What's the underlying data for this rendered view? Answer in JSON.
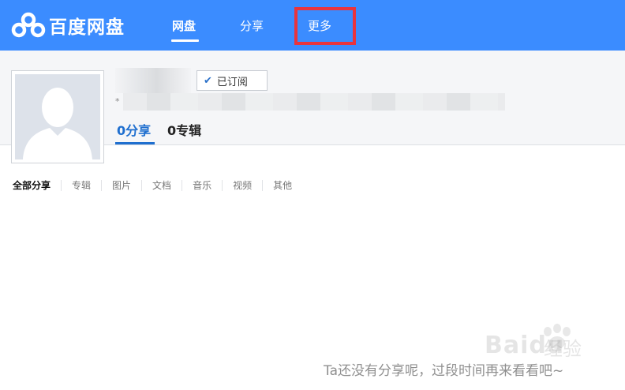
{
  "header": {
    "logo_text": "百度网盘",
    "nav": [
      {
        "label": "网盘",
        "active": true
      },
      {
        "label": "分享",
        "active": false
      },
      {
        "label": "更多",
        "active": false
      }
    ],
    "highlight_color": "#e8343d",
    "bar_color": "#3b8cff"
  },
  "profile": {
    "subscribe_label": "已订阅",
    "desc_marker": "*",
    "tabs": [
      {
        "label": "0分享",
        "active": true
      },
      {
        "label": "0专辑",
        "active": false
      }
    ]
  },
  "filters": [
    "全部分享",
    "专辑",
    "图片",
    "文档",
    "音乐",
    "视频",
    "其他"
  ],
  "empty_message": "Ta还没有分享呢，过段时间再来看看吧~",
  "watermark": {
    "text": "Baidu",
    "text2": "经验"
  }
}
